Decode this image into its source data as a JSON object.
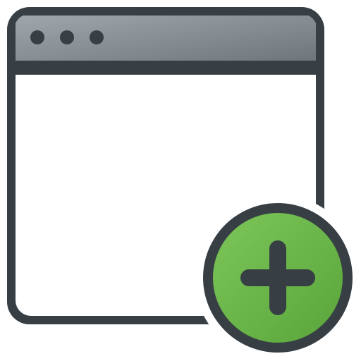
{
  "icon": {
    "name": "new-window",
    "window": {
      "titlebar_dots": 3
    },
    "badge": {
      "symbol": "plus"
    }
  },
  "colors": {
    "outline": "#373F45",
    "window_body": "#FFFFFF",
    "titlebar_light": "#A0A6AB",
    "titlebar_dark": "#6E767C",
    "badge_green": "#6BB649",
    "badge_green_light": "#7CC65A"
  }
}
